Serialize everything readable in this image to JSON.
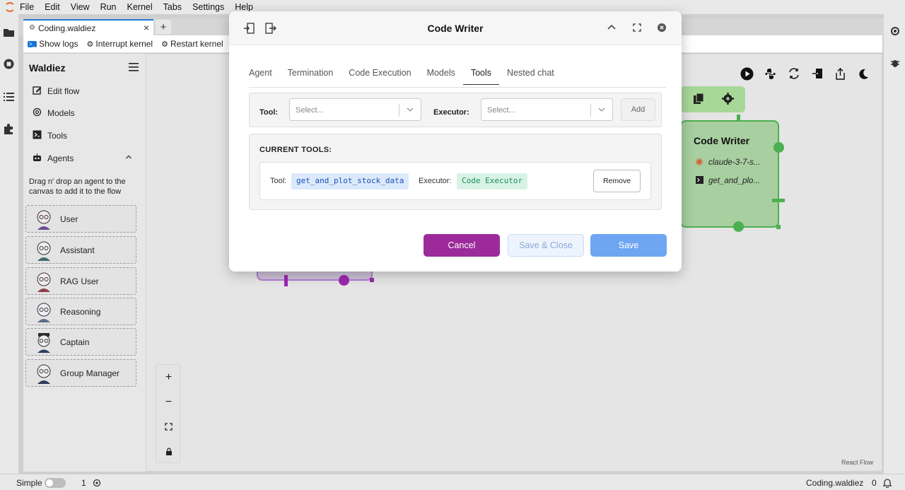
{
  "menubar": {
    "items": [
      "File",
      "Edit",
      "View",
      "Run",
      "Kernel",
      "Tabs",
      "Settings",
      "Help"
    ]
  },
  "tabs": {
    "doc_tab": "Coding.waldiez",
    "add": "+"
  },
  "toolbar": {
    "show_logs": "Show logs",
    "interrupt_kernel": "Interrupt kernel",
    "restart_kernel": "Restart kernel"
  },
  "sidebar": {
    "title": "Waldiez",
    "items": [
      {
        "label": "Edit flow",
        "icon": "edit-icon"
      },
      {
        "label": "Models",
        "icon": "openai-icon"
      },
      {
        "label": "Tools",
        "icon": "terminal-icon"
      },
      {
        "label": "Agents",
        "icon": "robot-icon"
      }
    ],
    "hint": "Drag n' drop an agent to the canvas to add it to the flow",
    "agents": [
      "User",
      "Assistant",
      "RAG User",
      "Reasoning",
      "Captain",
      "Group Manager"
    ]
  },
  "canvas": {
    "controls": {
      "zoom_in": "+",
      "zoom_out": "−"
    },
    "attribution": "React Flow",
    "node": {
      "title": "Code Writer",
      "model": "claude-3-7-s...",
      "tool": "get_and_plo..."
    }
  },
  "modal": {
    "title": "Code Writer",
    "tabs": [
      "Agent",
      "Termination",
      "Code Execution",
      "Models",
      "Tools",
      "Nested chat"
    ],
    "active_tab": "Tools",
    "tool_label": "Tool:",
    "tool_placeholder": "Select...",
    "executor_label": "Executor:",
    "executor_placeholder": "Select...",
    "add_button": "Add",
    "current_tools_title": "CURRENT TOOLS:",
    "current_tool": {
      "tool_label": "Tool:",
      "tool_value": "get_and_plot_stock_data",
      "executor_label": "Executor:",
      "executor_value": "Code Executor",
      "remove_button": "Remove"
    },
    "buttons": {
      "cancel": "Cancel",
      "save_close": "Save & Close",
      "save": "Save"
    },
    "colors": {
      "cancel": "#9c2a9a",
      "save": "#6fa6f2",
      "tool_chip": "#dce9fb",
      "executor_chip": "#d8f3e6"
    }
  },
  "statusbar": {
    "mode": "Simple",
    "count": "1",
    "file": "Coding.waldiez",
    "notifications": "0"
  }
}
